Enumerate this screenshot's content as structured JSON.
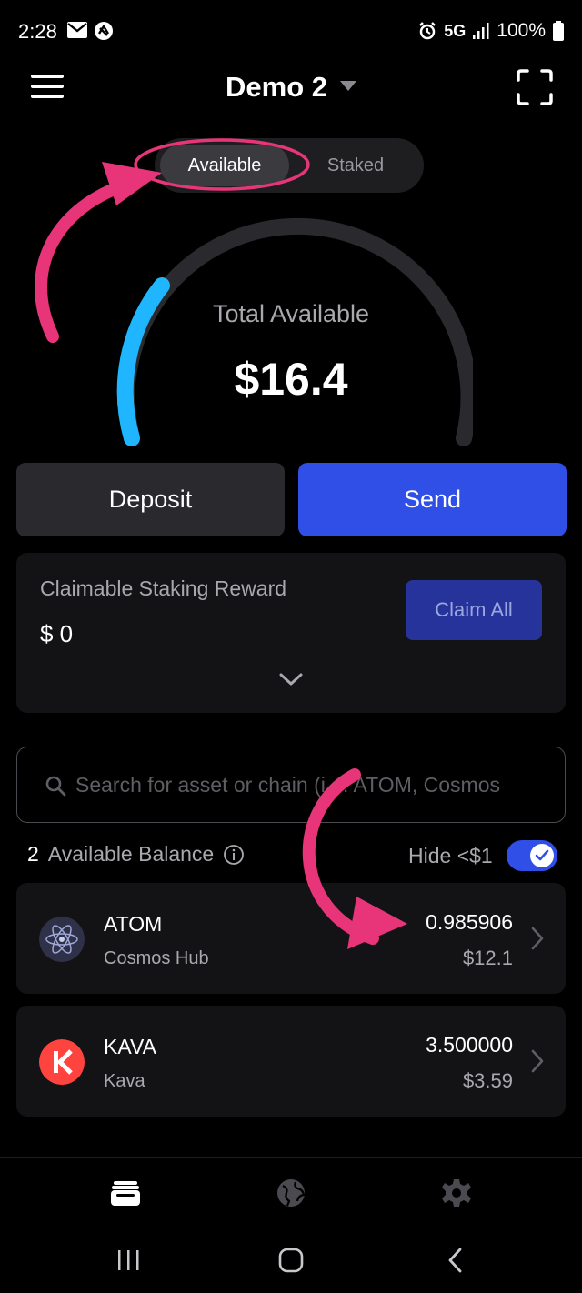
{
  "status_bar": {
    "time": "2:28",
    "network": "5G",
    "battery": "100%",
    "icons": [
      "mail-icon",
      "sync-icon",
      "alarm-icon",
      "signal-icon",
      "battery-icon"
    ]
  },
  "header": {
    "wallet_name": "Demo 2",
    "icons": [
      "menu-icon",
      "caret-down-icon",
      "scan-icon"
    ]
  },
  "toggle": {
    "available_label": "Available",
    "staked_label": "Staked",
    "selected": "Available"
  },
  "gauge": {
    "title": "Total Available",
    "value": "$16.4",
    "track_color": "#2a2a2e",
    "fill_color": "#1fb6ff"
  },
  "actions": {
    "deposit_label": "Deposit",
    "send_label": "Send",
    "send_color": "#2f4fe6"
  },
  "reward": {
    "label": "Claimable Staking Reward",
    "value": "$ 0",
    "claim_label": "Claim All"
  },
  "search": {
    "placeholder": "Search for asset or chain (i.e. ATOM, Cosmos"
  },
  "balance": {
    "count": "2",
    "label": "Available Balance",
    "hide_label": "Hide <$1",
    "hide_enabled": true
  },
  "assets": [
    {
      "symbol": "ATOM",
      "chain": "Cosmos Hub",
      "amount": "0.985906",
      "value": "$12.1",
      "icon": "cosmos-logo-icon"
    },
    {
      "symbol": "KAVA",
      "chain": "Kava",
      "amount": "3.500000",
      "value": "$3.59",
      "icon": "kava-logo-icon"
    }
  ],
  "bottom_nav": {
    "items": [
      "wallet-icon",
      "globe-icon",
      "settings-icon"
    ],
    "active": "wallet-icon"
  },
  "annotation_color": "#e8357a"
}
